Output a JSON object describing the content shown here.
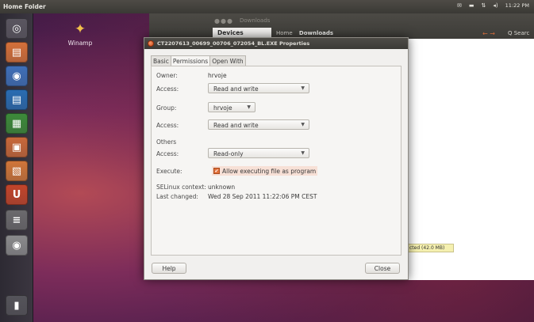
{
  "top_panel": {
    "title": "Home Folder",
    "tray": {
      "mail_icon": "✉",
      "battery_icon": "▬",
      "network_icon": "⇅",
      "volume_icon": "◂)",
      "clock": "11:22 PM"
    }
  },
  "launcher": {
    "icons": [
      {
        "name": "dash-icon",
        "glyph": "◎",
        "bg": "#5a5660"
      },
      {
        "name": "home-folder-icon",
        "glyph": "▤",
        "bg": "#d4703a"
      },
      {
        "name": "firefox-icon",
        "glyph": "◉",
        "bg": "#3f6fb8"
      },
      {
        "name": "writer-icon",
        "glyph": "▤",
        "bg": "#2a6cb2"
      },
      {
        "name": "calc-icon",
        "glyph": "▦",
        "bg": "#3d8a3a"
      },
      {
        "name": "impress-icon",
        "glyph": "▣",
        "bg": "#c8683a"
      },
      {
        "name": "software-center-icon",
        "glyph": "▧",
        "bg": "#d0763a"
      },
      {
        "name": "ubuntu-one-icon",
        "glyph": "U",
        "bg": "#c2452b"
      },
      {
        "name": "settings-icon",
        "glyph": "≡",
        "bg": "#6b6a6d"
      },
      {
        "name": "disc-icon",
        "glyph": "◉",
        "bg": "#8a8a8c"
      },
      {
        "name": "trash-icon",
        "glyph": "▮",
        "bg": "#55545a"
      }
    ]
  },
  "desktop": {
    "icon_label": "Winamp",
    "icon_glyph": "✦"
  },
  "background_window": {
    "window_buttons": "●●●",
    "title": "Downloads",
    "sidebar_header": "Devices",
    "breadcrumb_home": "Home",
    "breadcrumb_current": "Downloads",
    "nav_arrows": "← →",
    "search_label": "Q Searc",
    "status_text": "cted (42.0 MB)"
  },
  "dialog": {
    "title": "CT2207613_00699_00706_072054_BL.EXE Properties",
    "tabs": [
      {
        "label": "Basic",
        "active": false
      },
      {
        "label": "Permissions",
        "active": true
      },
      {
        "label": "Open With",
        "active": false
      }
    ],
    "owner_label": "Owner:",
    "owner_value": "hrvoje",
    "owner_access_label": "Access:",
    "owner_access_value": "Read and write",
    "group_label": "Group:",
    "group_value": "hrvoje",
    "group_access_label": "Access:",
    "group_access_value": "Read and write",
    "others_label": "Others",
    "others_access_label": "Access:",
    "others_access_value": "Read-only",
    "execute_label": "Execute:",
    "execute_checkbox_label": "Allow executing file as program",
    "execute_checked": true,
    "selinux_label": "SELinux context:",
    "selinux_value": "unknown",
    "last_changed_label": "Last changed:",
    "last_changed_value": "Wed 28 Sep 2011 11:22:06 PM CEST",
    "help_label": "Help",
    "close_label": "Close",
    "combo_arrow": "▼",
    "check_mark": "✔"
  }
}
